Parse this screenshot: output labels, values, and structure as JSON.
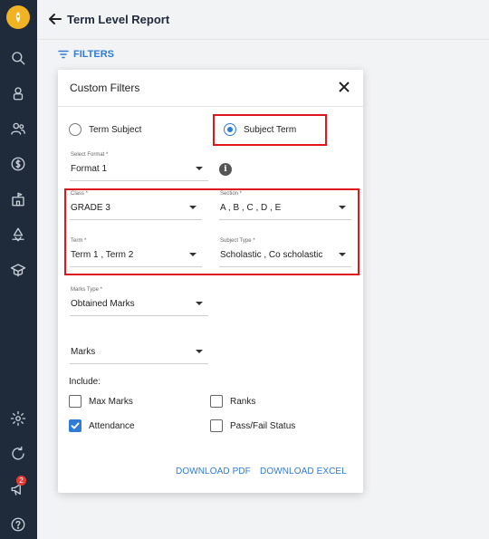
{
  "header": {
    "title": "Term Level Report"
  },
  "filters_button": {
    "label": "FILTERS"
  },
  "modal": {
    "title": "Custom Filters",
    "radios": [
      {
        "label": "Term Subject",
        "selected": false
      },
      {
        "label": "Subject Term",
        "selected": true
      }
    ],
    "format": {
      "label": "Select Format *",
      "value": "Format 1"
    },
    "class": {
      "label": "Class *",
      "value": "GRADE 3"
    },
    "section": {
      "label": "Section *",
      "value": "A , B , C , D , E"
    },
    "term": {
      "label": "Term *",
      "value": "Term 1 , Term 2"
    },
    "subject_type": {
      "label": "Subject Type *",
      "value": "Scholastic , Co scholastic"
    },
    "marks_type": {
      "label": "Marks Type *",
      "value": "Obtained Marks"
    },
    "marks": {
      "value": "Marks"
    },
    "include_label": "Include:",
    "checkboxes": [
      {
        "label": "Max Marks",
        "checked": false
      },
      {
        "label": "Ranks",
        "checked": false
      },
      {
        "label": "Attendance",
        "checked": true
      },
      {
        "label": "Pass/Fail Status",
        "checked": false
      }
    ],
    "download_pdf": "DOWNLOAD PDF",
    "download_excel": "DOWNLOAD EXCEL"
  },
  "sidebar": {
    "icons": [
      "search-icon",
      "hourglass-icon",
      "users-icon",
      "dollar-icon",
      "building-icon",
      "recycle-icon",
      "graduation-icon",
      "settings-icon",
      "refresh-icon",
      "megaphone-icon",
      "help-icon"
    ],
    "notification_count": "2"
  },
  "colors": {
    "accent": "#2f7bd6",
    "sidebar": "#1f2a3a",
    "highlight": "#e0161d",
    "logo": "#f0b323"
  }
}
